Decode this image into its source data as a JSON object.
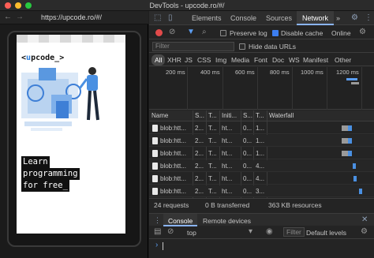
{
  "window": {
    "title": "DevTools - upcode.ro/#/"
  },
  "preview": {
    "back_glyph": "←",
    "forward_glyph": "→",
    "url": "https://upcode.ro/#/",
    "logo": {
      "open": "<",
      "brand_u": "u",
      "brand_rest": "pcode",
      "close": "_>"
    },
    "hero": [
      "Learn",
      "programming",
      "for free_"
    ]
  },
  "devtools": {
    "tabs": [
      "Elements",
      "Console",
      "Sources",
      "Network"
    ],
    "more_tabs_glyph": "»",
    "active_tab": "Network",
    "toolbar": {
      "preserve_log_label": "Preserve log",
      "preserve_log_checked": false,
      "disable_cache_label": "Disable cache",
      "disable_cache_checked": true,
      "throttling": "Online"
    },
    "filter": {
      "placeholder": "Filter",
      "hide_data_urls_label": "Hide data URLs"
    },
    "types": [
      "All",
      "XHR",
      "JS",
      "CSS",
      "Img",
      "Media",
      "Font",
      "Doc",
      "WS",
      "Manifest",
      "Other"
    ],
    "timeline_ticks": [
      "200 ms",
      "400 ms",
      "600 ms",
      "800 ms",
      "1000 ms",
      "1200 ms"
    ],
    "columns": [
      "Name",
      "S...",
      "T...",
      "Initi...",
      "S...",
      "T...",
      "Waterfall"
    ],
    "rows": [
      {
        "name": "blob:htt...",
        "s": "2...",
        "t": "T...",
        "init": "ht...",
        "size": "0...",
        "time": "1..."
      },
      {
        "name": "blob:htt...",
        "s": "2...",
        "t": "T...",
        "init": "ht...",
        "size": "0...",
        "time": "1..."
      },
      {
        "name": "blob:htt...",
        "s": "2...",
        "t": "T...",
        "init": "ht...",
        "size": "0...",
        "time": "1..."
      },
      {
        "name": "blob:htt...",
        "s": "2...",
        "t": "T...",
        "init": "ht...",
        "size": "0...",
        "time": "4..."
      },
      {
        "name": "blob:htt...",
        "s": "2...",
        "t": "T...",
        "init": "ht...",
        "size": "0...",
        "time": "4..."
      },
      {
        "name": "blob:htt...",
        "s": "2...",
        "t": "T...",
        "init": "ht...",
        "size": "0...",
        "time": "3..."
      }
    ],
    "summary": {
      "requests": "24 requests",
      "transferred": "0 B transferred",
      "resources": "363 KB resources"
    },
    "drawer": {
      "tabs": [
        "Console",
        "Remote devices"
      ],
      "context": "top",
      "filter_placeholder": "Filter",
      "levels": "Default levels",
      "prompt": "›"
    }
  },
  "colors": {
    "record": "#e24a4a",
    "active_tab_underline": "#8ab4f8",
    "checkbox_on": "#3c7ef0",
    "waterfall_bar": "#4a90e2"
  }
}
